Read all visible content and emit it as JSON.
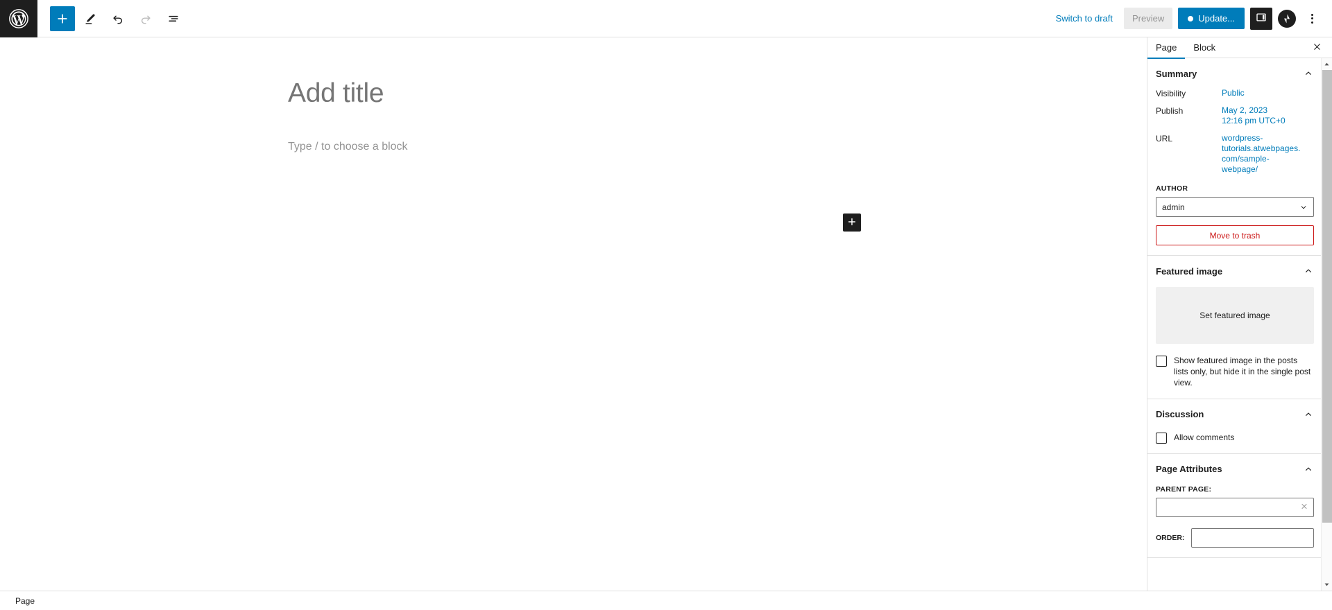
{
  "topbar": {
    "logo_icon": "wordpress-logo-icon",
    "tools": [
      {
        "name": "add-block-button",
        "icon": "plus-icon",
        "label": "Add block",
        "style": "primary",
        "disabled": false
      },
      {
        "name": "tools-button",
        "icon": "pencil-icon",
        "label": "Tools",
        "style": "plain",
        "disabled": false
      },
      {
        "name": "undo-button",
        "icon": "undo-icon",
        "label": "Undo",
        "style": "plain",
        "disabled": false
      },
      {
        "name": "redo-button",
        "icon": "redo-icon",
        "label": "Redo",
        "style": "plain",
        "disabled": true
      },
      {
        "name": "list-view-button",
        "icon": "list-view-icon",
        "label": "Document overview",
        "style": "plain",
        "disabled": false
      }
    ],
    "switch_to_draft_label": "Switch to draft",
    "preview_label": "Preview",
    "update_label": "Update...",
    "settings_toggle_label": "Settings",
    "avatar_label": "A",
    "options_menu_label": "Options"
  },
  "editor": {
    "title_placeholder": "Add title",
    "paragraph_placeholder": "Type / to choose a block",
    "appender_label": "+"
  },
  "sidebar": {
    "tabs": [
      {
        "label": "Page",
        "active": true
      },
      {
        "label": "Block",
        "active": false
      }
    ],
    "close_label": "Close settings",
    "summary": {
      "title": "Summary",
      "visibility_label": "Visibility",
      "visibility_value": "Public",
      "publish_label": "Publish",
      "publish_date": "May 2, 2023",
      "publish_time": "12:16 pm UTC+0",
      "url_label": "URL",
      "url_lines": [
        "wordpress-",
        "tutorials.atwebpages.",
        "com/sample-",
        "webpage/"
      ],
      "author_label": "AUTHOR",
      "author_value": "admin",
      "author_options": [
        "admin"
      ],
      "trash_label": "Move to trash"
    },
    "featured_image": {
      "title": "Featured image",
      "placeholder_label": "Set featured image",
      "checkbox_label": "Show featured image in the posts lists only, but hide it in the single post view.",
      "checkbox_checked": false
    },
    "discussion": {
      "title": "Discussion",
      "allow_comments_label": "Allow comments",
      "allow_comments_checked": false
    },
    "page_attributes": {
      "title": "Page Attributes",
      "parent_page_label": "PARENT PAGE:",
      "parent_page_value": "",
      "parent_page_placeholder": "",
      "order_label": "ORDER:",
      "order_value": ""
    }
  },
  "statusbar": {
    "document_type": "Page"
  },
  "colors": {
    "accent": "#007cba",
    "dark": "#1e1e1e",
    "danger": "#cc1818",
    "border": "#e0e0e0",
    "muted": "#757575"
  }
}
